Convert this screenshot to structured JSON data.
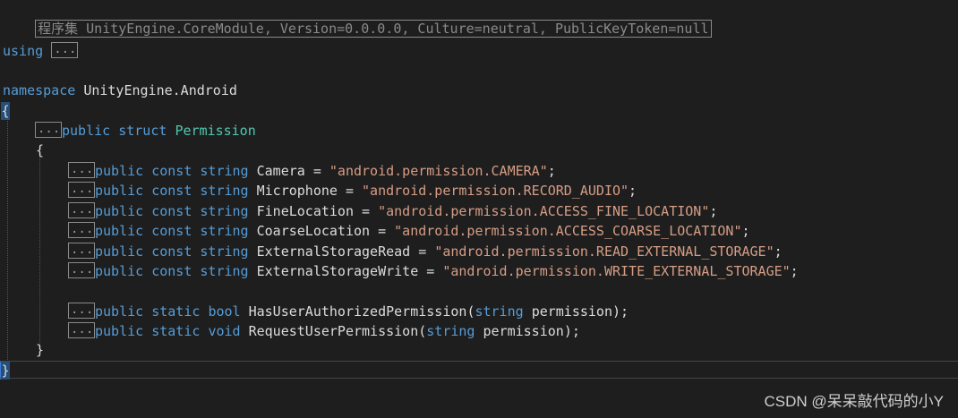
{
  "assembly_header": "程序集 UnityEngine.CoreModule, Version=0.0.0.0, Culture=neutral, PublicKeyToken=null",
  "using": {
    "keyword": "using",
    "collapsed": "..."
  },
  "namespace": {
    "keyword": "namespace",
    "name": "UnityEngine.Android",
    "open_brace": "{",
    "close_brace": "}"
  },
  "struct": {
    "collapsed": "...",
    "modifier": "public",
    "keyword": "struct",
    "name": "Permission",
    "open_brace": "{",
    "close_brace": "}"
  },
  "constants": [
    {
      "collapsed": "...",
      "mod": "public",
      "const": "const",
      "type": "string",
      "name": "Camera",
      "value": "\"android.permission.CAMERA\""
    },
    {
      "collapsed": "...",
      "mod": "public",
      "const": "const",
      "type": "string",
      "name": "Microphone",
      "value": "\"android.permission.RECORD_AUDIO\""
    },
    {
      "collapsed": "...",
      "mod": "public",
      "const": "const",
      "type": "string",
      "name": "FineLocation",
      "value": "\"android.permission.ACCESS_FINE_LOCATION\""
    },
    {
      "collapsed": "...",
      "mod": "public",
      "const": "const",
      "type": "string",
      "name": "CoarseLocation",
      "value": "\"android.permission.ACCESS_COARSE_LOCATION\""
    },
    {
      "collapsed": "...",
      "mod": "public",
      "const": "const",
      "type": "string",
      "name": "ExternalStorageRead",
      "value": "\"android.permission.READ_EXTERNAL_STORAGE\""
    },
    {
      "collapsed": "...",
      "mod": "public",
      "const": "const",
      "type": "string",
      "name": "ExternalStorageWrite",
      "value": "\"android.permission.WRITE_EXTERNAL_STORAGE\""
    }
  ],
  "methods": [
    {
      "collapsed": "...",
      "mod": "public",
      "static": "static",
      "ret": "bool",
      "name": "HasUserAuthorizedPermission",
      "ptype": "string",
      "pname": "permission"
    },
    {
      "collapsed": "...",
      "mod": "public",
      "static": "static",
      "ret": "void",
      "name": "RequestUserPermission",
      "ptype": "string",
      "pname": "permission"
    }
  ],
  "watermark": "CSDN @呆呆敲代码的小Y",
  "colors": {
    "background": "#1e1e1e",
    "keyword": "#569cd6",
    "type": "#4ec9b0",
    "string": "#d69d85",
    "text": "#dcdcdc"
  }
}
